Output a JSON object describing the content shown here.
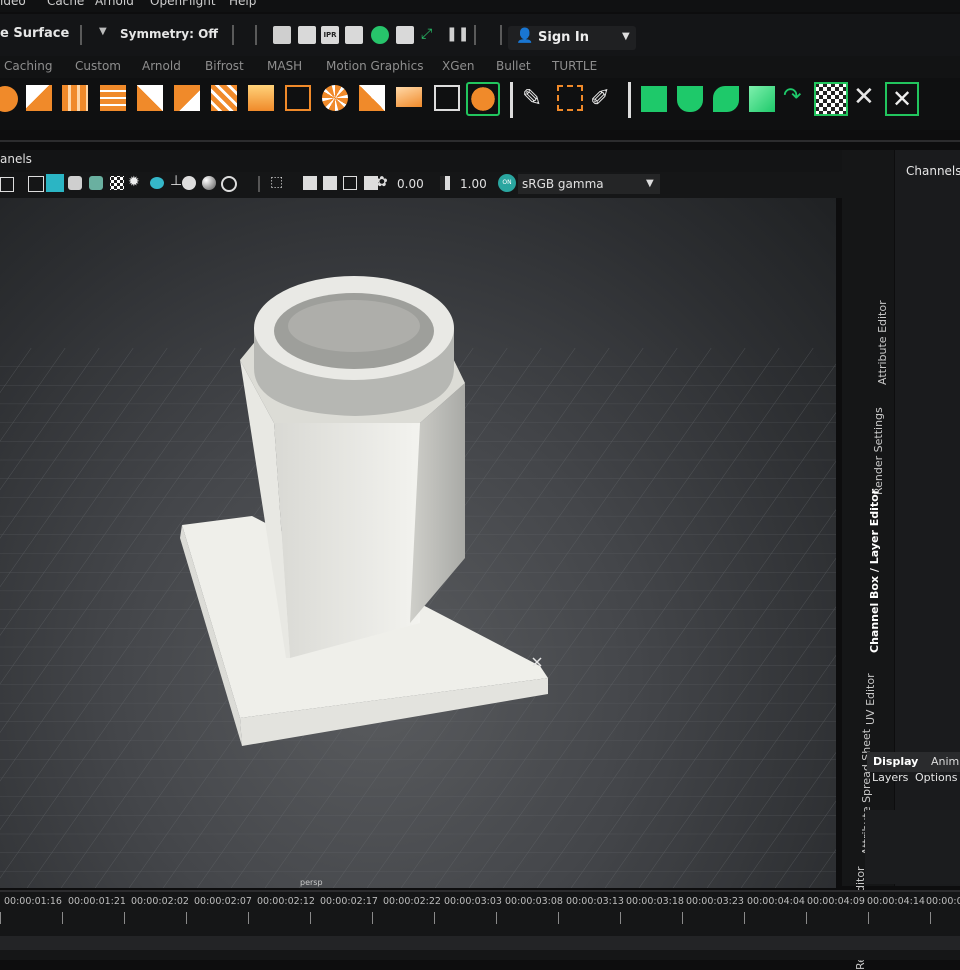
{
  "menu": [
    "Cache",
    "Arnold",
    "OpenFlight",
    "Help"
  ],
  "status": {
    "surface_label": "e Surface",
    "symmetry_label": "Symmetry: Off",
    "signin_label": "Sign In"
  },
  "shelf_tabs": [
    "Caching",
    "Custom",
    "Arnold",
    "Bifrost",
    "MASH",
    "Motion Graphics",
    "XGen",
    "Bullet",
    "TURTLE"
  ],
  "panel": {
    "channels_header": "anels",
    "exposure_value": "0.00",
    "gamma_value": "1.00",
    "colorspace": "sRGB gamma",
    "camera_label": "persp"
  },
  "right_panel": {
    "title": "Channels",
    "vertical_tabs": [
      "Attribute Editor",
      "Render Settings",
      "Channel Box / Layer Editor",
      "UV Editor",
      "Attribute Spread Sheet",
      "Relationship Editor"
    ],
    "layer_tabs": [
      "Display",
      "Anim"
    ],
    "layer_menu": [
      "Layers",
      "Options"
    ]
  },
  "timeline": {
    "labels": [
      "00:00:01:16",
      "00:00:01:21",
      "00:00:02:02",
      "00:00:02:07",
      "00:00:02:12",
      "00:00:02:17",
      "00:00:02:22",
      "00:00:03:03",
      "00:00:03:08",
      "00:00:03:13",
      "00:00:03:18",
      "00:00:03:23",
      "00:00:04:04",
      "00:00:04:09",
      "00:00:04:14",
      "00:00:0"
    ]
  }
}
